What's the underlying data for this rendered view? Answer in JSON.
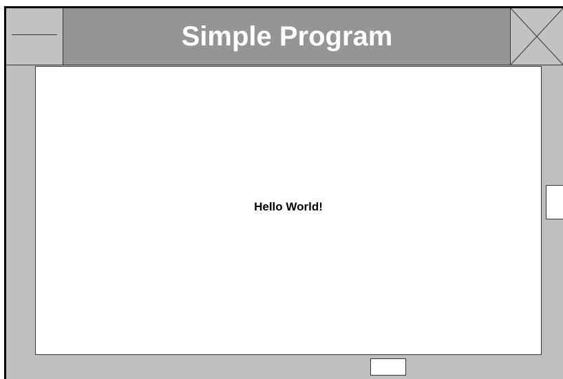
{
  "window": {
    "title": "Simple Program"
  },
  "titlebar": {
    "menu_icon": "minimize-dash-icon",
    "close_icon": "close-x-icon"
  },
  "content": {
    "message": "Hello World!"
  },
  "colors": {
    "titlebar": "#959595",
    "frame": "#bfbfbf",
    "client": "#ffffff",
    "title_text": "#ffffff"
  }
}
